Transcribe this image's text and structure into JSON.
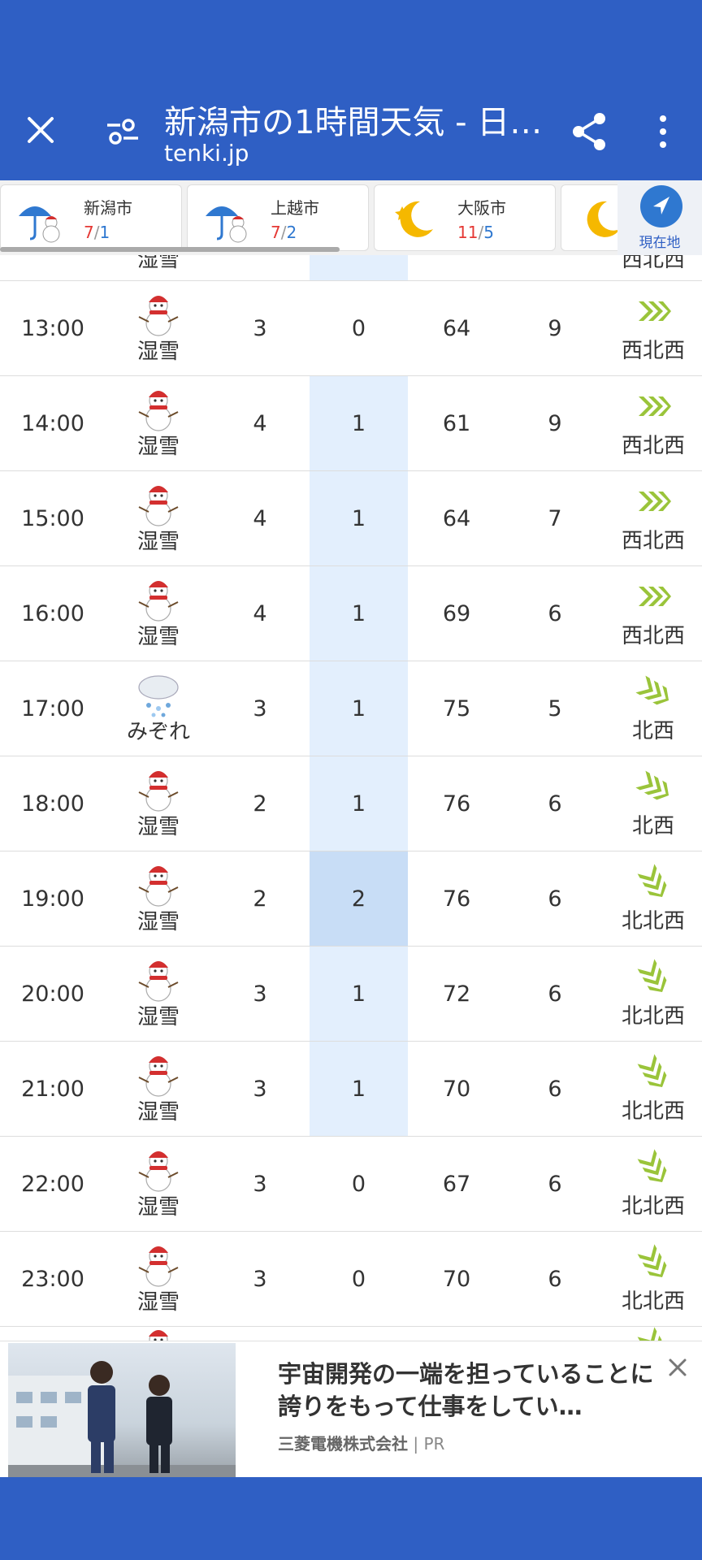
{
  "header": {
    "title": "新潟市の1時間天気 - 日…",
    "subtitle": "tenki.jp"
  },
  "cities": [
    {
      "name": "新潟市",
      "a": "7",
      "b": "1",
      "icon": "umbrella-snowman-icon"
    },
    {
      "name": "上越市",
      "a": "7",
      "b": "2",
      "icon": "umbrella-snowman-icon"
    },
    {
      "name": "大阪市",
      "a": "11",
      "b": "5",
      "icon": "moon-star-icon"
    }
  ],
  "location_button": {
    "label": "現在地"
  },
  "rows": [
    {
      "time": "13:00",
      "weather": "湿雪",
      "icon": "snowman-icon",
      "temp": "3",
      "precip": "0",
      "humidity": "64",
      "wind": "9",
      "dir": "西北西"
    },
    {
      "time": "14:00",
      "weather": "湿雪",
      "icon": "snowman-icon",
      "temp": "4",
      "precip": "1",
      "humidity": "61",
      "wind": "9",
      "dir": "西北西"
    },
    {
      "time": "15:00",
      "weather": "湿雪",
      "icon": "snowman-icon",
      "temp": "4",
      "precip": "1",
      "humidity": "64",
      "wind": "7",
      "dir": "西北西"
    },
    {
      "time": "16:00",
      "weather": "湿雪",
      "icon": "snowman-icon",
      "temp": "4",
      "precip": "1",
      "humidity": "69",
      "wind": "6",
      "dir": "西北西"
    },
    {
      "time": "17:00",
      "weather": "みぞれ",
      "icon": "sleet-cloud-icon",
      "temp": "3",
      "precip": "1",
      "humidity": "75",
      "wind": "5",
      "dir": "北西"
    },
    {
      "time": "18:00",
      "weather": "湿雪",
      "icon": "snowman-icon",
      "temp": "2",
      "precip": "1",
      "humidity": "76",
      "wind": "6",
      "dir": "北西"
    },
    {
      "time": "19:00",
      "weather": "湿雪",
      "icon": "snowman-icon",
      "temp": "2",
      "precip": "2",
      "humidity": "76",
      "wind": "6",
      "dir": "北北西"
    },
    {
      "time": "20:00",
      "weather": "湿雪",
      "icon": "snowman-icon",
      "temp": "3",
      "precip": "1",
      "humidity": "72",
      "wind": "6",
      "dir": "北北西"
    },
    {
      "time": "21:00",
      "weather": "湿雪",
      "icon": "snowman-icon",
      "temp": "3",
      "precip": "1",
      "humidity": "70",
      "wind": "6",
      "dir": "北北西"
    },
    {
      "time": "22:00",
      "weather": "湿雪",
      "icon": "snowman-icon",
      "temp": "3",
      "precip": "0",
      "humidity": "67",
      "wind": "6",
      "dir": "北北西"
    },
    {
      "time": "23:00",
      "weather": "湿雪",
      "icon": "snowman-icon",
      "temp": "3",
      "precip": "0",
      "humidity": "70",
      "wind": "6",
      "dir": "北北西"
    }
  ],
  "partial_top": {
    "weather": "湿雪",
    "dir": "西北西"
  },
  "ad": {
    "headline": "宇宙開発の一端を担っていることに誇りをもって仕事をしてい…",
    "advertiser": "三菱電機株式会社",
    "tag": "PR"
  },
  "colors": {
    "primary": "#2f5fc4",
    "precip_bg": "#e3effd",
    "precip_hi": "#c8ddf6",
    "wind_green": "#9ac43a"
  }
}
